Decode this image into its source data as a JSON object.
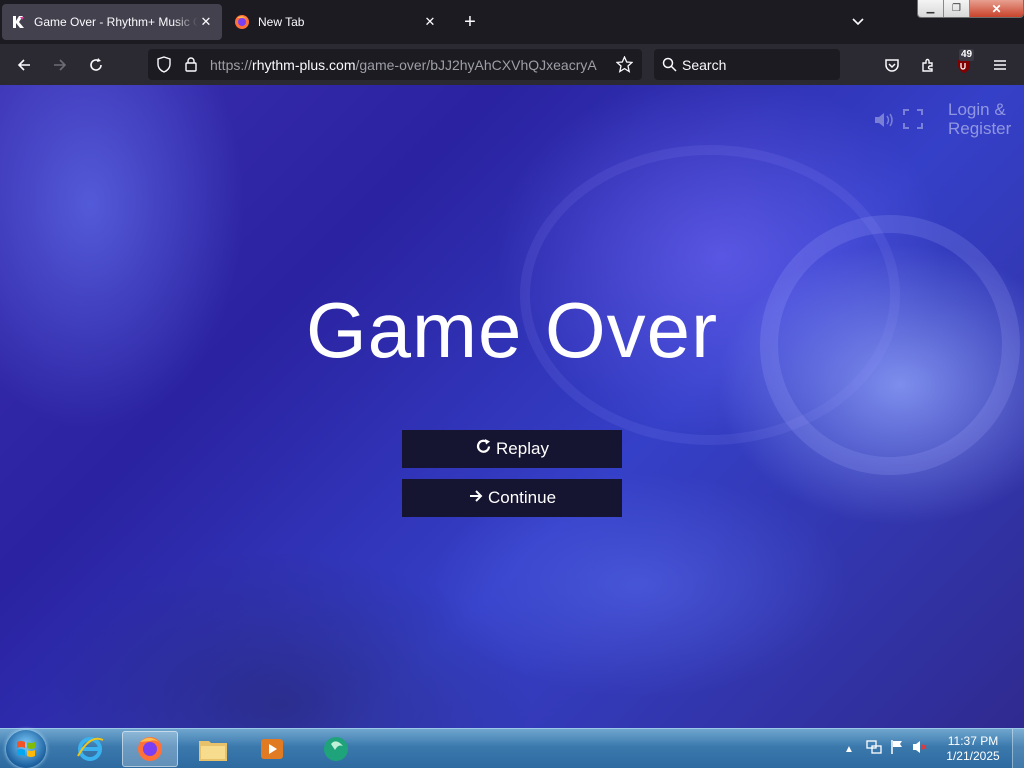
{
  "browser": {
    "tabs": [
      {
        "title": "Game Over - Rhythm+ Music Game",
        "active": true
      },
      {
        "title": "New Tab",
        "active": false
      }
    ],
    "url_prefix": "https://",
    "url_domain": "rhythm-plus.com",
    "url_path": "/game-over/bJJ2hyAhCXVhQJxeacryA",
    "search_placeholder": "Search",
    "extension_badge": "49"
  },
  "page": {
    "login_line1": "Login &",
    "login_line2": "Register",
    "heading": "Game Over",
    "replay_label": "Replay",
    "continue_label": "Continue"
  },
  "taskbar": {
    "time": "11:37 PM",
    "date": "1/21/2025"
  }
}
